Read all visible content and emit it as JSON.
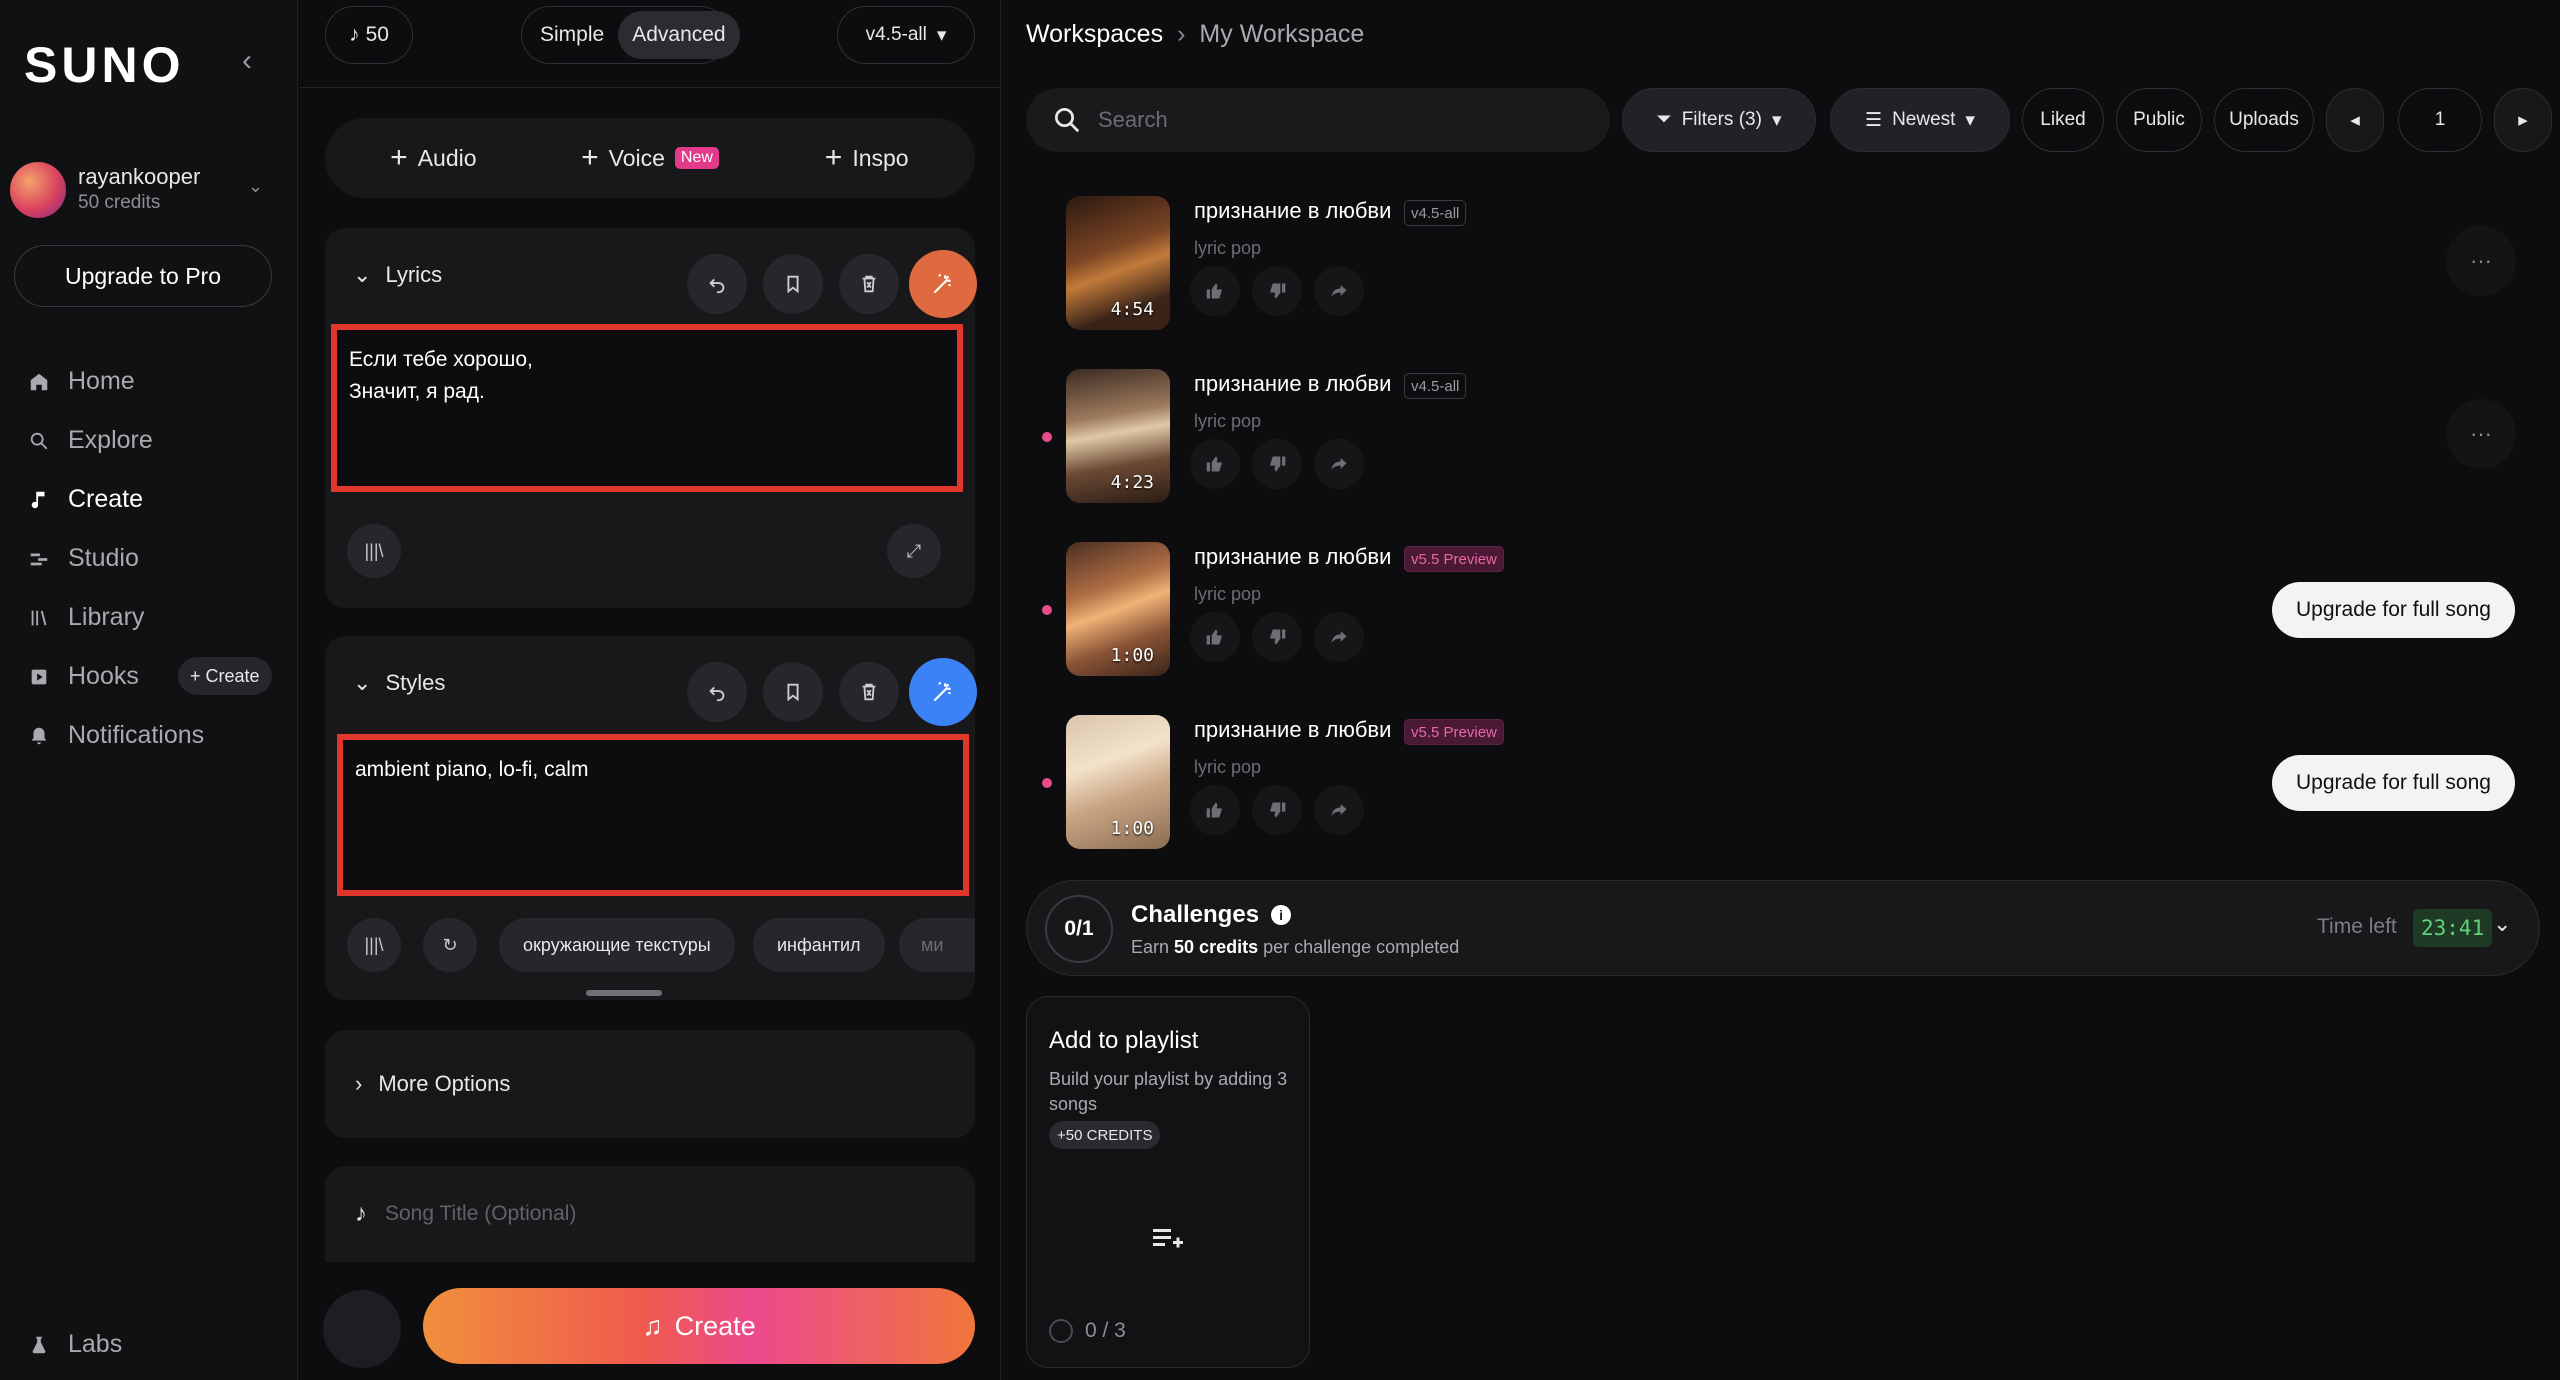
{
  "sidebar": {
    "logo": "SUNO",
    "user": {
      "name": "rayankooper",
      "credits": "50 credits"
    },
    "upgrade_label": "Upgrade to Pro",
    "nav": [
      {
        "label": "Home",
        "icon": "home-icon"
      },
      {
        "label": "Explore",
        "icon": "search-icon"
      },
      {
        "label": "Create",
        "icon": "music-note-icon",
        "active": true
      },
      {
        "label": "Studio",
        "icon": "studio-icon"
      },
      {
        "label": "Library",
        "icon": "library-icon"
      },
      {
        "label": "Hooks",
        "icon": "hooks-icon"
      },
      {
        "label": "Notifications",
        "icon": "bell-icon"
      }
    ],
    "hooks_create_label": "+ Create",
    "labs_label": "Labs"
  },
  "create_panel": {
    "credits": "50",
    "modes": [
      "Simple",
      "Advanced"
    ],
    "active_mode": "Advanced",
    "version": "v4.5-all",
    "add_buttons": {
      "audio": "Audio",
      "voice": "Voice",
      "voice_badge": "New",
      "inspo": "Inspo"
    },
    "lyrics": {
      "label": "Lyrics",
      "text": "Если тебе хорошо,\nЗначит, я рад."
    },
    "styles": {
      "label": "Styles",
      "text": "ambient piano, lo-fi, calm",
      "tags": [
        "окружающие текстуры",
        "инфантил",
        "ми"
      ]
    },
    "more_options_label": "More Options",
    "song_title_placeholder": "Song Title (Optional)",
    "create_label": "Create"
  },
  "workspace": {
    "breadcrumb_root": "Workspaces",
    "breadcrumb_current": "My Workspace",
    "search_placeholder": "Search",
    "filters_label": "Filters (3)",
    "sort_label": "Newest",
    "liked_label": "Liked",
    "public_label": "Public",
    "uploads_label": "Uploads",
    "page_number": "1",
    "songs": [
      {
        "title": "признание в любви",
        "version": "v4.5-all",
        "genre": "lyric pop",
        "duration": "4:54",
        "preview": false,
        "dot": false
      },
      {
        "title": "признание в любви",
        "version": "v4.5-all",
        "genre": "lyric pop",
        "duration": "4:23",
        "preview": false,
        "dot": true
      },
      {
        "title": "признание в любви",
        "version": "v5.5 Preview",
        "genre": "lyric pop",
        "duration": "1:00",
        "preview": true,
        "dot": true,
        "upgrade": "Upgrade for full song"
      },
      {
        "title": "признание в любви",
        "version": "v5.5 Preview",
        "genre": "lyric pop",
        "duration": "1:00",
        "preview": true,
        "dot": true,
        "upgrade": "Upgrade for full song"
      }
    ],
    "challenges": {
      "count": "0/1",
      "title": "Challenges",
      "sub_prefix": "Earn ",
      "sub_bold": "50 credits",
      "sub_suffix": " per challenge completed",
      "time_left_label": "Time left",
      "timer": "23:41"
    },
    "playlist_card": {
      "title": "Add to playlist",
      "description": "Build your playlist by adding 3 songs",
      "badge": "+50 CREDITS",
      "progress": "0 / 3"
    }
  },
  "colors": {
    "accent_red": "#e0362b",
    "magic_orange": "#e06a40",
    "magic_blue": "#3b82f6",
    "preview_pink": "#e767a7",
    "timer_green": "#5fd37a"
  }
}
